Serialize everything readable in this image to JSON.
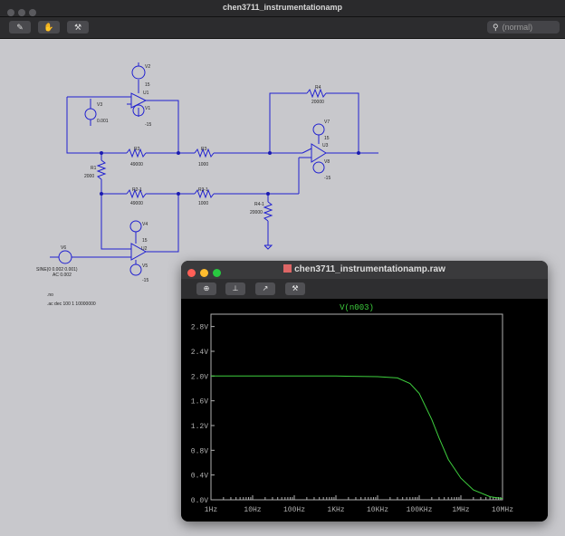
{
  "window": {
    "title": "chen3711_instrumentationamp"
  },
  "toolbar": {
    "buttons": [
      {
        "name": "probe-icon",
        "glyph": "✎"
      },
      {
        "name": "hand-icon",
        "glyph": "✋"
      },
      {
        "name": "hammer-icon",
        "glyph": "⚒"
      }
    ],
    "search_placeholder": "(normal)"
  },
  "schematic": {
    "V2": "V2",
    "V2_val": "15",
    "V1": "V1",
    "V1_val": "-15",
    "V3": "V3",
    "V3_val": "0.001",
    "U1": "U1",
    "R4": "R4",
    "R4_val": "20000",
    "V7": "V7",
    "V7_val": "15",
    "U3": "U3",
    "V8": "V8",
    "V8_val": "-15",
    "R2": "R2",
    "R2_val": "49000",
    "R3": "R3",
    "R3_val": "1000",
    "R1": "R1",
    "R1_val": "2000",
    "R2_1": "R2-1",
    "R2_1_val": "49000",
    "R3_1": "R3-1",
    "R3_1_val": "1000",
    "R4_1": "R4-1",
    "R4_1_val": "20000",
    "V4": "V4",
    "V4_val": "15",
    "U2": "U2",
    "V5": "V5",
    "V5_val": "-15",
    "V6": "V6",
    "V6_sine": "SINE(0 0.002 0.001)",
    "V6_ac": "AC 0.002",
    "directive_noise": ".no",
    "directive_ac": ".ac dec 100 1 10000000"
  },
  "plot_window": {
    "title": "chen3711_instrumentationamp.raw",
    "toolbar": [
      "zoom-icon",
      "axis-icon",
      "export-icon",
      "hammer-icon"
    ],
    "trace_label": "V(n003)",
    "colors": {
      "trace": "#3ecf3e",
      "axis": "#b0b0b0",
      "background": "#000000"
    }
  },
  "chart_data": {
    "type": "line",
    "title": "V(n003)",
    "xscale": "log",
    "xlim": [
      1,
      10000000
    ],
    "ylim": [
      0,
      3.0
    ],
    "x_tick_labels": [
      "1Hz",
      "10Hz",
      "100Hz",
      "1KHz",
      "10KHz",
      "100KHz",
      "1MHz",
      "10MHz"
    ],
    "y_tick_labels": [
      "0.0V",
      "0.4V",
      "0.8V",
      "1.2V",
      "1.6V",
      "2.0V",
      "2.4V",
      "2.8V"
    ],
    "y_ticks": [
      0,
      0.4,
      0.8,
      1.2,
      1.6,
      2.0,
      2.4,
      2.8
    ],
    "series": [
      {
        "name": "V(n003)",
        "x": [
          1,
          10,
          100,
          1000,
          10000,
          30000,
          60000,
          100000,
          200000,
          300000,
          500000,
          1000000,
          2000000,
          5000000,
          10000000
        ],
        "y": [
          2.0,
          2.0,
          2.0,
          2.0,
          1.99,
          1.97,
          1.88,
          1.72,
          1.3,
          1.0,
          0.65,
          0.35,
          0.16,
          0.05,
          0.02
        ]
      }
    ]
  }
}
